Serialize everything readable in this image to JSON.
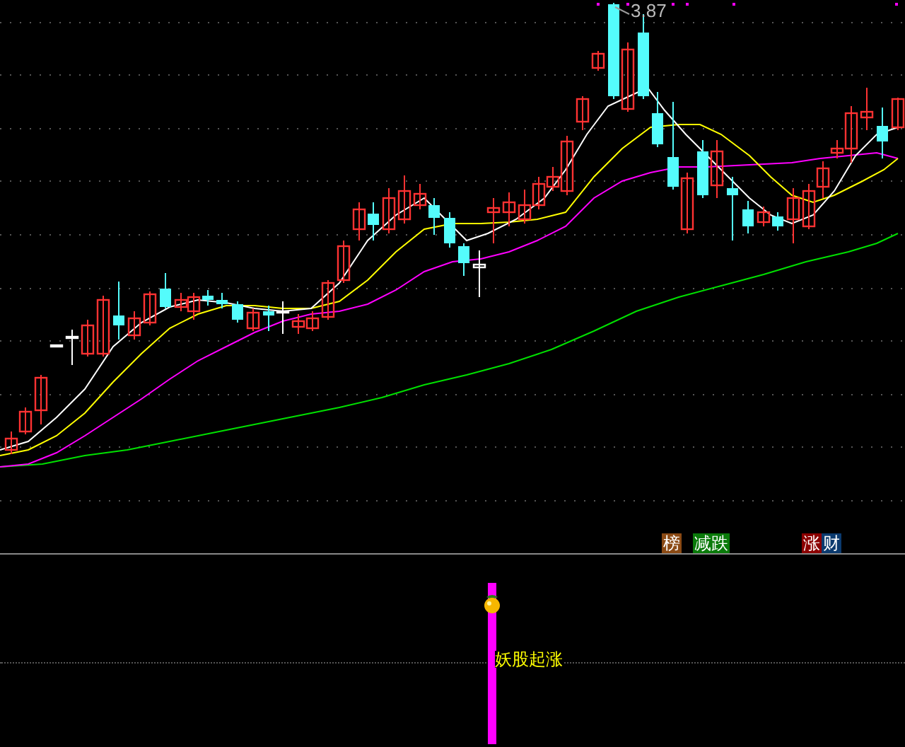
{
  "main_chart": {
    "high_label": "3.87"
  },
  "badges": [
    {
      "text": "榜",
      "color": "#8b4a14"
    },
    {
      "text": "减跌",
      "color": "#0a7a0a"
    },
    {
      "text": "涨",
      "color": "#8b0000"
    },
    {
      "text": "财",
      "color": "#0b3a6e"
    }
  ],
  "signal": {
    "text": "妖股起涨"
  }
}
